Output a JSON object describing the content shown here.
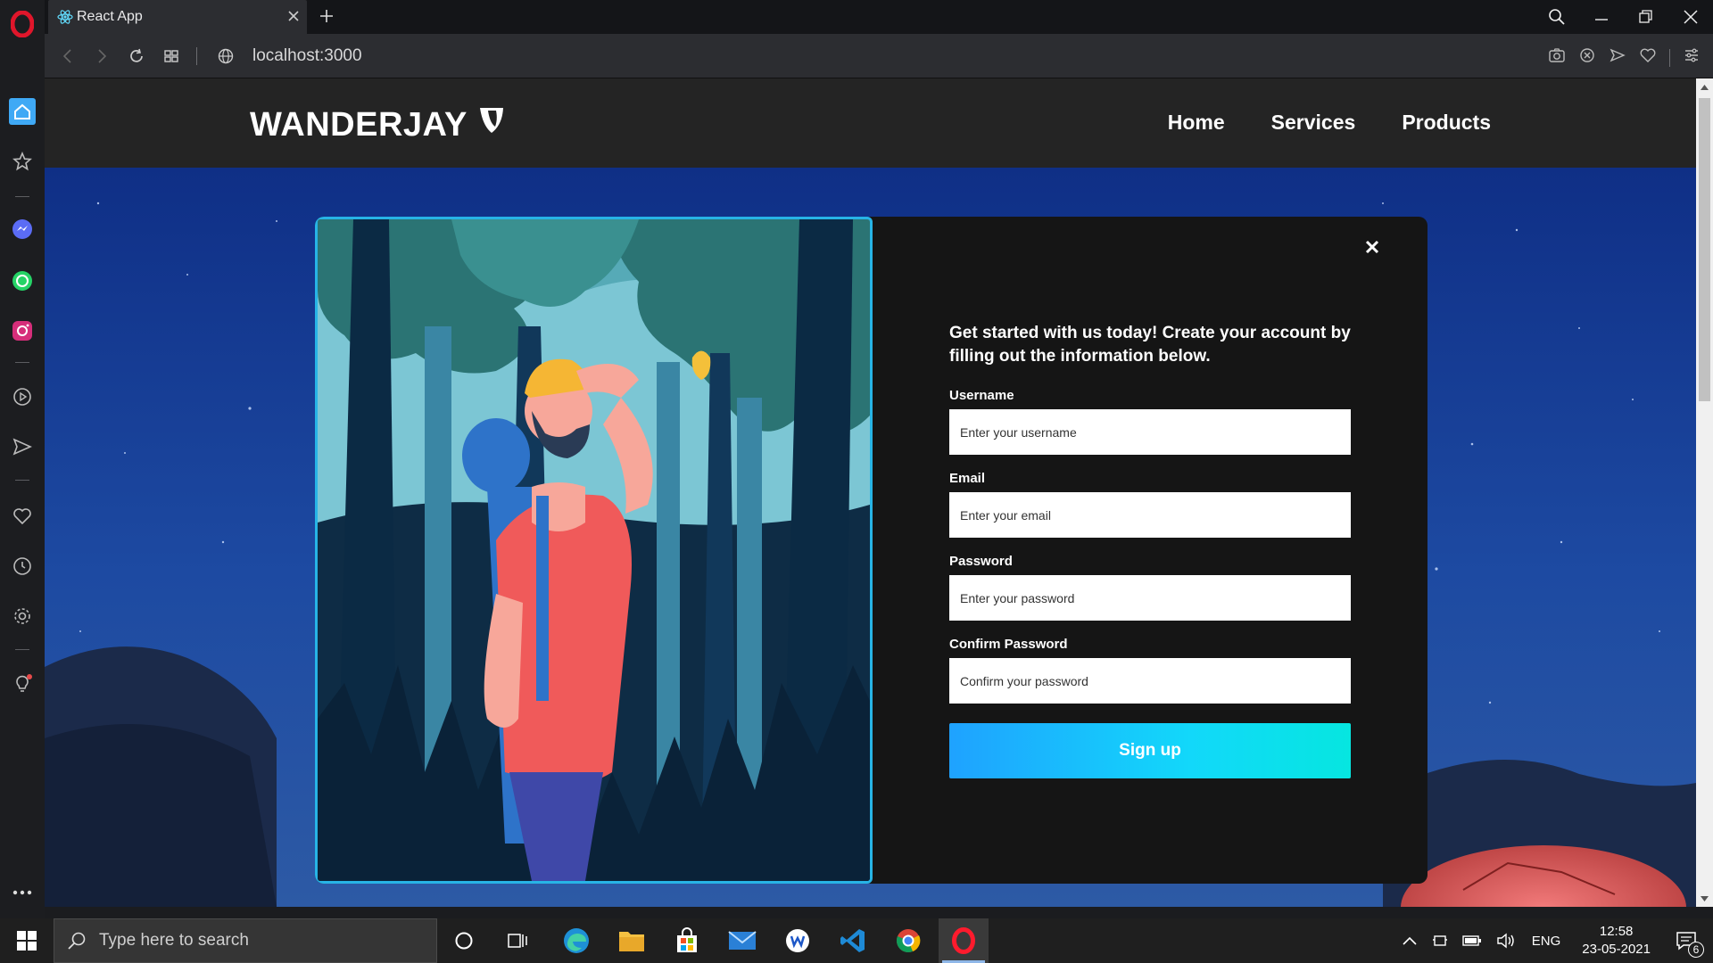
{
  "browser": {
    "tab": {
      "title": "React App"
    },
    "address": {
      "url": "localhost:3000"
    }
  },
  "site": {
    "logo_text": "WANDERJAY",
    "nav": [
      {
        "label": "Home"
      },
      {
        "label": "Services"
      },
      {
        "label": "Products"
      }
    ]
  },
  "signup_modal": {
    "intro": "Get started with us today! Create your account by filling out the information below.",
    "fields": [
      {
        "label": "Username",
        "placeholder": "Enter your username",
        "value": ""
      },
      {
        "label": "Email",
        "placeholder": "Enter your email",
        "value": ""
      },
      {
        "label": "Password",
        "placeholder": "Enter your password",
        "value": ""
      },
      {
        "label": "Confirm Password",
        "placeholder": "Confirm your password",
        "value": ""
      }
    ],
    "submit_label": "Sign up",
    "close_icon": "close-icon"
  },
  "taskbar": {
    "search_placeholder": "Type here to search",
    "language": "ENG",
    "time": "12:58",
    "date": "23-05-2021",
    "notification_count": "6"
  },
  "colors": {
    "accent": "#1fa2ff",
    "accent_end": "#06e6e0",
    "modal_bg": "#151515",
    "nav_bg": "#242424",
    "image_border": "#27b4e6"
  }
}
